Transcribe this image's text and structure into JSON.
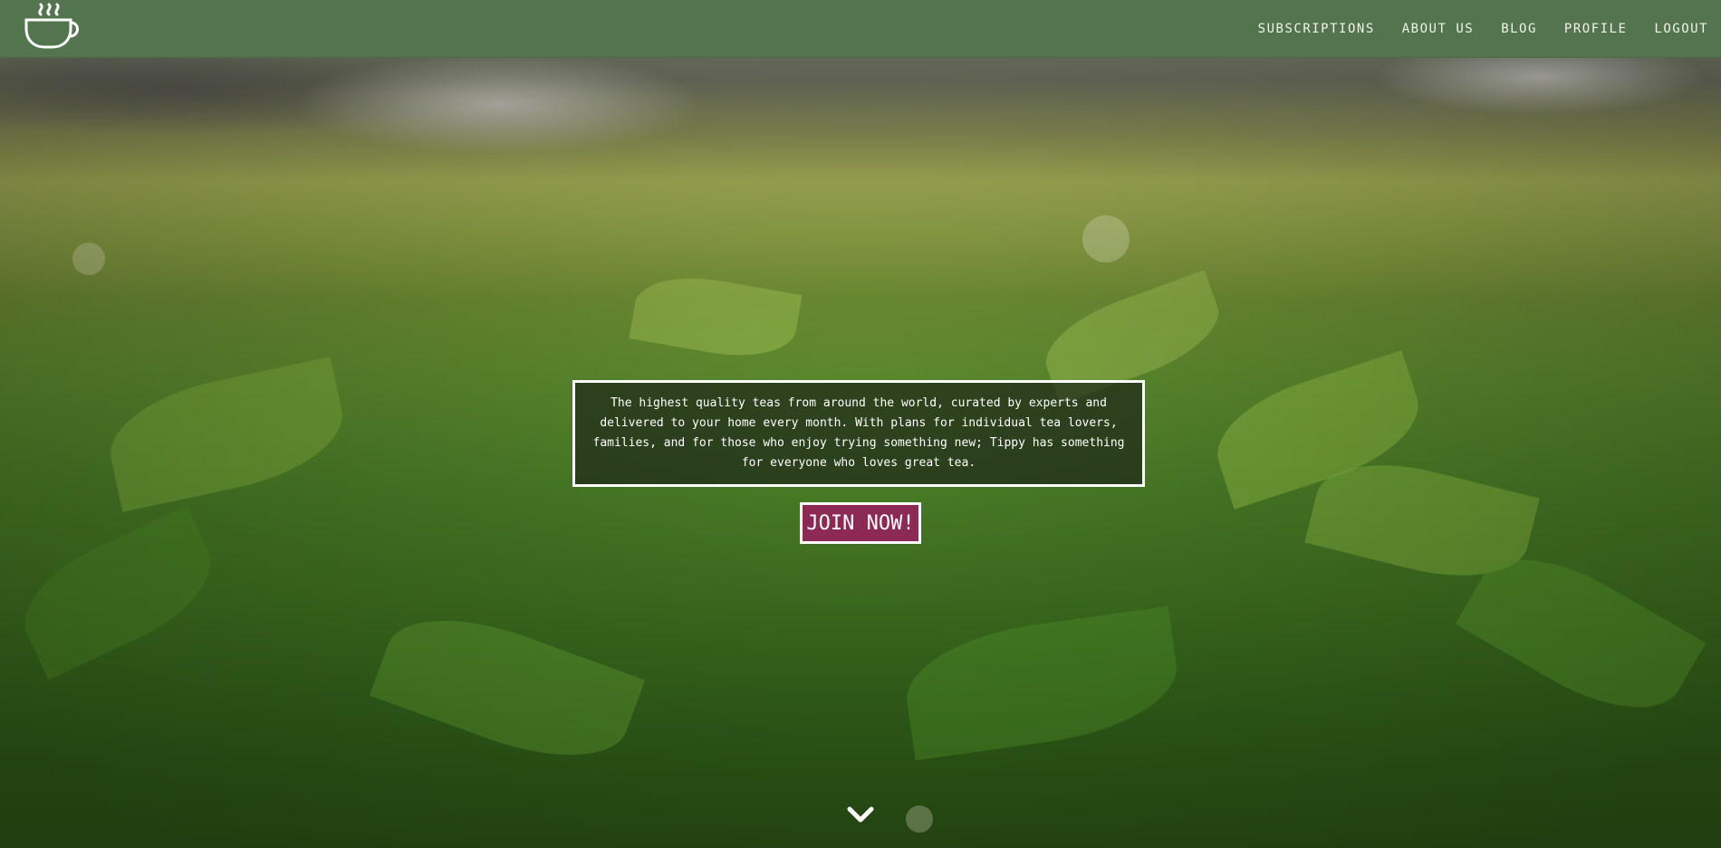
{
  "nav": {
    "logo_icon": "tea-cup-icon",
    "links": [
      {
        "label": "SUBSCRIPTIONS"
      },
      {
        "label": "ABOUT US"
      },
      {
        "label": "BLOG"
      },
      {
        "label": "PROFILE"
      },
      {
        "label": "LOGOUT"
      }
    ]
  },
  "hero": {
    "intro": "The highest quality teas from around the world, curated by experts and delivered to your home every month. With plans for individual tea lovers, families, and for those who enjoy trying something new; Tippy has something for everyone who loves great tea.",
    "join_label": "JOIN NOW!",
    "scroll_icon": "chevron-down-icon"
  },
  "colors": {
    "nav_bg": "#53754d",
    "join_bg": "#8c2a55",
    "text": "#ffffff"
  }
}
